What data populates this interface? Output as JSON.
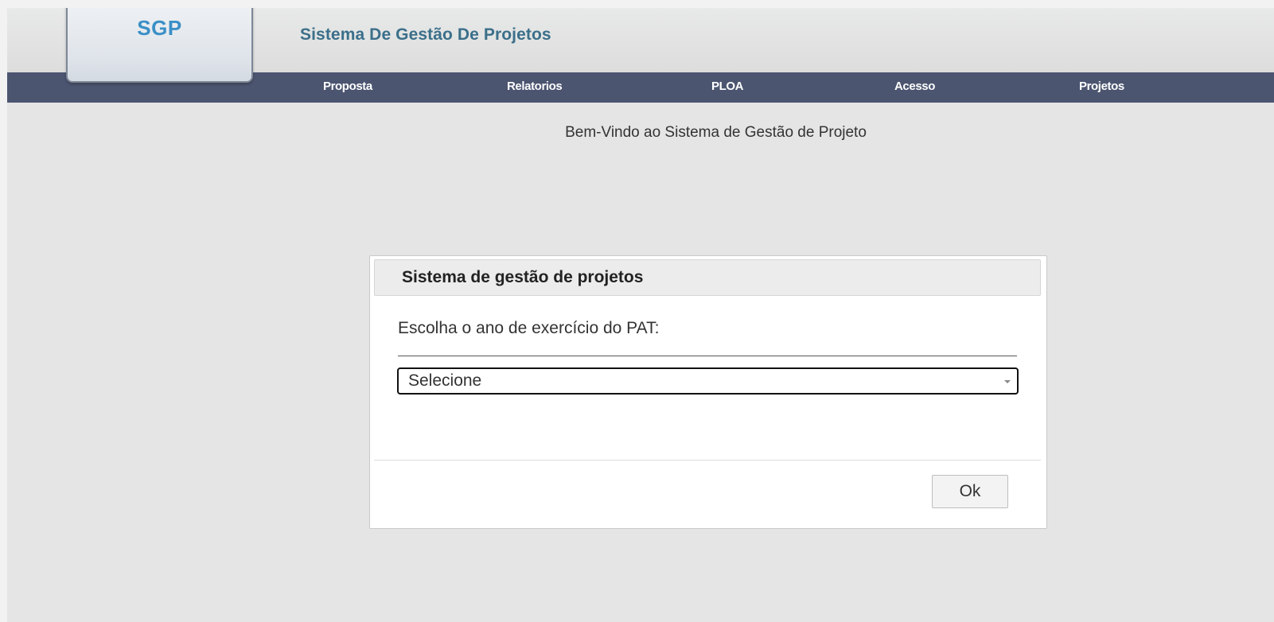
{
  "logo": {
    "text": "SGP"
  },
  "header": {
    "title": "Sistema De Gestão De Projetos"
  },
  "nav": {
    "items": [
      {
        "label": "Proposta"
      },
      {
        "label": "Relatorios"
      },
      {
        "label": "PLOA"
      },
      {
        "label": "Acesso"
      },
      {
        "label": "Projetos"
      }
    ]
  },
  "main": {
    "welcome": "Bem-Vindo ao Sistema de Gestão de Projeto"
  },
  "dialog": {
    "title": "Sistema de gestão de projetos",
    "prompt": "Escolha o ano de exercício do PAT:",
    "select": {
      "value": "Selecione"
    },
    "ok_label": "Ok"
  },
  "colors": {
    "nav_background": "#4b5570",
    "logo_text": "#3a8fc6",
    "title_text": "#3b6f8a",
    "page_background": "#e5e5e5"
  }
}
